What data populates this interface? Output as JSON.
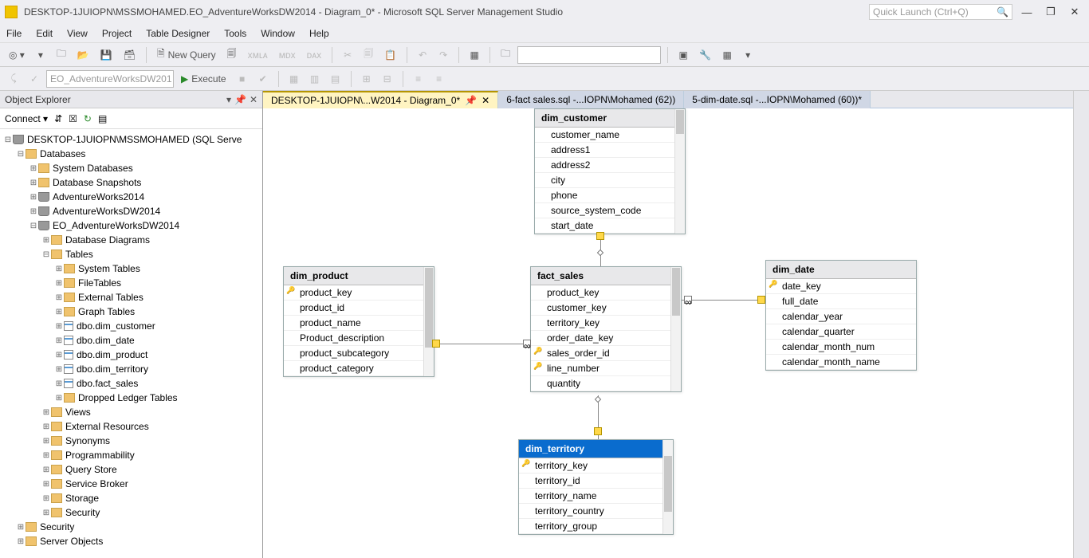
{
  "title": "DESKTOP-1JUIOPN\\MSSMOHAMED.EO_AdventureWorksDW2014 - Diagram_0* - Microsoft SQL Server Management Studio",
  "quicklaunch_placeholder": "Quick Launch (Ctrl+Q)",
  "menu": [
    "File",
    "Edit",
    "View",
    "Project",
    "Table Designer",
    "Tools",
    "Window",
    "Help"
  ],
  "newquery_label": "New Query",
  "execute_label": "Execute",
  "db_combo": "EO_AdventureWorksDW201",
  "objexp_title": "Object Explorer",
  "connect_label": "Connect",
  "tree": {
    "server": "DESKTOP-1JUIOPN\\MSSMOHAMED (SQL Serve",
    "databases": "Databases",
    "sysdb": "System Databases",
    "dbsnap": "Database Snapshots",
    "aw": "AdventureWorks2014",
    "awdw": "AdventureWorksDW2014",
    "eo": "EO_AdventureWorksDW2014",
    "dbdiag": "Database Diagrams",
    "tables": "Tables",
    "syst": "System Tables",
    "filet": "FileTables",
    "extt": "External Tables",
    "grapht": "Graph Tables",
    "t1": "dbo.dim_customer",
    "t2": "dbo.dim_date",
    "t3": "dbo.dim_product",
    "t4": "dbo.dim_territory",
    "t5": "dbo.fact_sales",
    "dropped": "Dropped Ledger Tables",
    "views": "Views",
    "extres": "External Resources",
    "syn": "Synonyms",
    "prog": "Programmability",
    "qs": "Query Store",
    "sb": "Service Broker",
    "stor": "Storage",
    "sec": "Security",
    "sec2": "Security",
    "servobj": "Server Objects"
  },
  "tabs": [
    "DESKTOP-1JUIOPN\\...W2014 - Diagram_0*",
    "6-fact sales.sql -...IOPN\\Mohamed (62))",
    "5-dim-date.sql -...IOPN\\Mohamed (60))*"
  ],
  "tables": {
    "dim_customer": {
      "title": "dim_customer",
      "cols": [
        "customer_name",
        "address1",
        "address2",
        "city",
        "phone",
        "source_system_code",
        "start_date"
      ]
    },
    "dim_product": {
      "title": "dim_product",
      "cols": [
        {
          "n": "product_key",
          "k": true
        },
        "product_id",
        "product_name",
        "Product_description",
        "product_subcategory",
        "product_category"
      ]
    },
    "fact_sales": {
      "title": "fact_sales",
      "cols": [
        "product_key",
        "customer_key",
        "territory_key",
        "order_date_key",
        {
          "n": "sales_order_id",
          "k": true
        },
        {
          "n": "line_number",
          "k": true
        },
        "quantity"
      ]
    },
    "dim_date": {
      "title": "dim_date",
      "cols": [
        {
          "n": "date_key",
          "k": true
        },
        "full_date",
        "calendar_year",
        "calendar_quarter",
        "calendar_month_num",
        "calendar_month_name"
      ]
    },
    "dim_territory": {
      "title": "dim_territory",
      "cols": [
        {
          "n": "territory_key",
          "k": true
        },
        "territory_id",
        "territory_name",
        "territory_country",
        "territory_group"
      ]
    }
  }
}
